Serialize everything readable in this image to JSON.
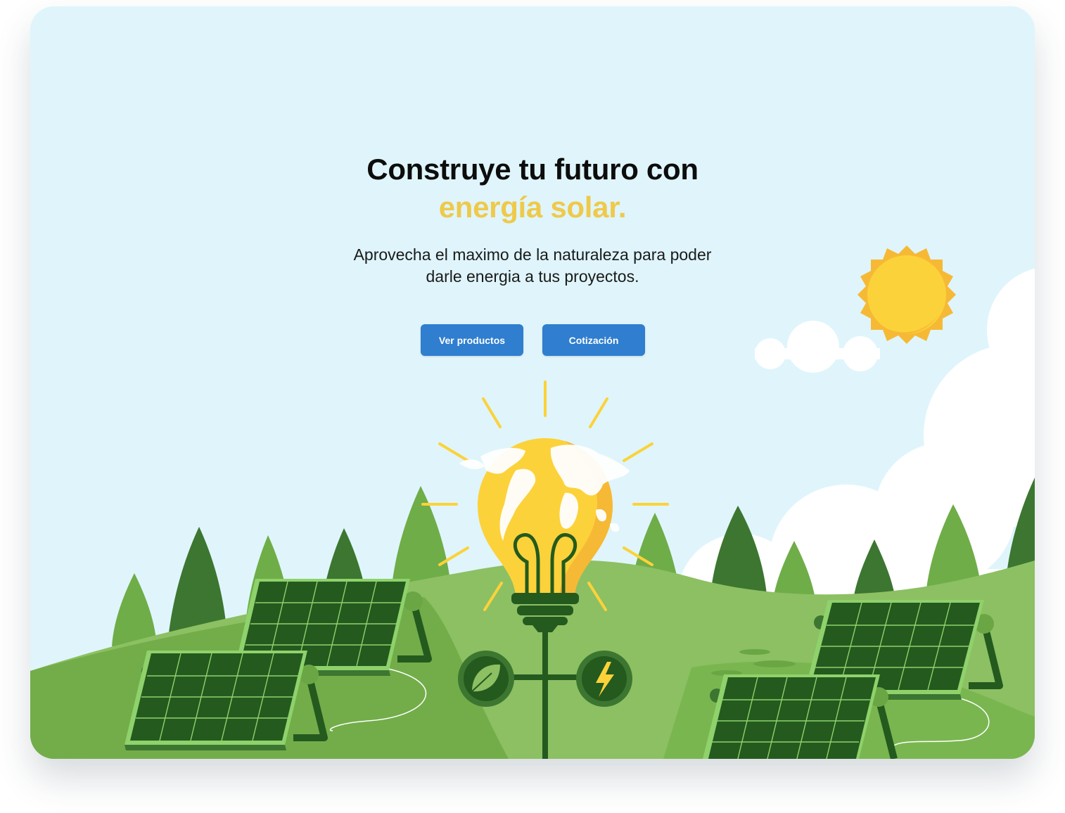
{
  "hero": {
    "title_line1": "Construye tu futuro con",
    "title_line2": "energía solar.",
    "subtitle_line1": "Aprovecha el maximo de la naturaleza para poder",
    "subtitle_line2": "darle energia a tus proyectos."
  },
  "buttons": {
    "products_label": "Ver productos",
    "quote_label": "Cotización"
  },
  "colors": {
    "sky": "#dff5fb",
    "accent_yellow": "#efc94a",
    "button_blue": "#2f7ecf",
    "hill_light": "#8cc063",
    "hill_dark": "#6aa744",
    "panel_dark": "#245a1e",
    "tree_dark": "#3c7630",
    "tree_light": "#6fad48"
  },
  "icons": {
    "sun": "sun-icon",
    "bulb": "lightbulb-icon",
    "globe": "globe-icon",
    "leaf": "leaf-icon",
    "bolt": "lightning-bolt-icon",
    "cloud": "cloud-icon",
    "panel": "solar-panel-icon",
    "tree": "tree-icon"
  }
}
